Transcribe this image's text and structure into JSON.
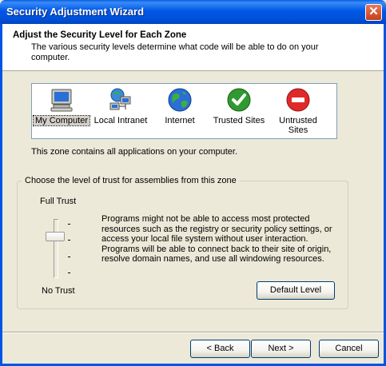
{
  "window": {
    "title": "Security Adjustment Wizard",
    "close_glyph": "✕"
  },
  "header": {
    "title": "Adjust the Security Level for Each Zone",
    "description": "The various security levels determine what code will be able to do on your computer."
  },
  "zones": [
    {
      "label": "My Computer",
      "icon": "computer-icon",
      "selected": true
    },
    {
      "label": "Local Intranet",
      "icon": "network-icon",
      "selected": false
    },
    {
      "label": "Internet",
      "icon": "globe-icon",
      "selected": false
    },
    {
      "label": "Trusted Sites",
      "icon": "checkmark-icon",
      "selected": false
    },
    {
      "label": "Untrusted Sites",
      "icon": "no-entry-icon",
      "selected": false
    }
  ],
  "zone_description": "This zone contains all applications on your computer.",
  "trust_group": {
    "legend": "Choose the level of trust for assemblies from this zone",
    "top_label": "Full Trust",
    "bottom_label": "No Trust",
    "slider_level": 0.75,
    "description": "Programs might not be able to access most protected resources such as the registry or security policy settings, or access your local file system without user interaction. Programs will be able to connect back to their site of origin, resolve domain names, and use all windowing resources.",
    "default_button": "Default Level"
  },
  "footer": {
    "back": "< Back",
    "next": "Next >",
    "cancel": "Cancel"
  },
  "colors": {
    "title_bar": "#0055e5",
    "close_button": "#d4502c",
    "dialog_bg": "#ece9d8"
  }
}
